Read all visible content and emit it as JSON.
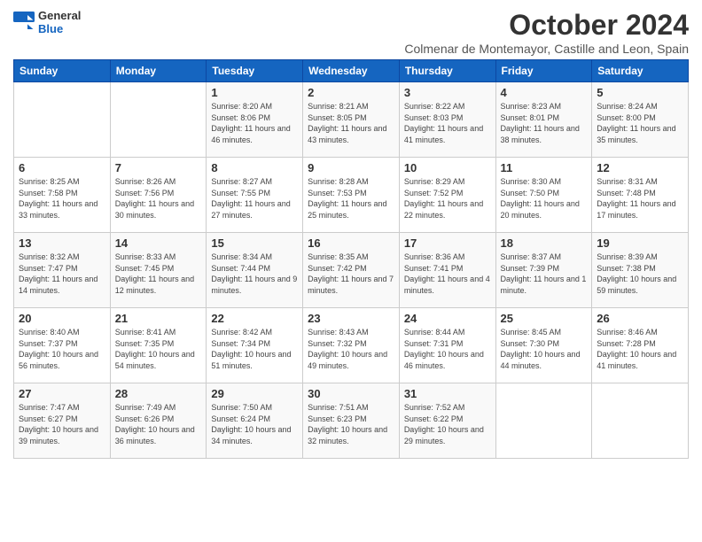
{
  "header": {
    "logo_general": "General",
    "logo_blue": "Blue",
    "title": "October 2024",
    "subtitle": "Colmenar de Montemayor, Castille and Leon, Spain"
  },
  "days_of_week": [
    "Sunday",
    "Monday",
    "Tuesday",
    "Wednesday",
    "Thursday",
    "Friday",
    "Saturday"
  ],
  "weeks": [
    {
      "days": [
        {
          "number": "",
          "info": ""
        },
        {
          "number": "",
          "info": ""
        },
        {
          "number": "1",
          "info": "Sunrise: 8:20 AM\nSunset: 8:06 PM\nDaylight: 11 hours and 46 minutes."
        },
        {
          "number": "2",
          "info": "Sunrise: 8:21 AM\nSunset: 8:05 PM\nDaylight: 11 hours and 43 minutes."
        },
        {
          "number": "3",
          "info": "Sunrise: 8:22 AM\nSunset: 8:03 PM\nDaylight: 11 hours and 41 minutes."
        },
        {
          "number": "4",
          "info": "Sunrise: 8:23 AM\nSunset: 8:01 PM\nDaylight: 11 hours and 38 minutes."
        },
        {
          "number": "5",
          "info": "Sunrise: 8:24 AM\nSunset: 8:00 PM\nDaylight: 11 hours and 35 minutes."
        }
      ]
    },
    {
      "days": [
        {
          "number": "6",
          "info": "Sunrise: 8:25 AM\nSunset: 7:58 PM\nDaylight: 11 hours and 33 minutes."
        },
        {
          "number": "7",
          "info": "Sunrise: 8:26 AM\nSunset: 7:56 PM\nDaylight: 11 hours and 30 minutes."
        },
        {
          "number": "8",
          "info": "Sunrise: 8:27 AM\nSunset: 7:55 PM\nDaylight: 11 hours and 27 minutes."
        },
        {
          "number": "9",
          "info": "Sunrise: 8:28 AM\nSunset: 7:53 PM\nDaylight: 11 hours and 25 minutes."
        },
        {
          "number": "10",
          "info": "Sunrise: 8:29 AM\nSunset: 7:52 PM\nDaylight: 11 hours and 22 minutes."
        },
        {
          "number": "11",
          "info": "Sunrise: 8:30 AM\nSunset: 7:50 PM\nDaylight: 11 hours and 20 minutes."
        },
        {
          "number": "12",
          "info": "Sunrise: 8:31 AM\nSunset: 7:48 PM\nDaylight: 11 hours and 17 minutes."
        }
      ]
    },
    {
      "days": [
        {
          "number": "13",
          "info": "Sunrise: 8:32 AM\nSunset: 7:47 PM\nDaylight: 11 hours and 14 minutes."
        },
        {
          "number": "14",
          "info": "Sunrise: 8:33 AM\nSunset: 7:45 PM\nDaylight: 11 hours and 12 minutes."
        },
        {
          "number": "15",
          "info": "Sunrise: 8:34 AM\nSunset: 7:44 PM\nDaylight: 11 hours and 9 minutes."
        },
        {
          "number": "16",
          "info": "Sunrise: 8:35 AM\nSunset: 7:42 PM\nDaylight: 11 hours and 7 minutes."
        },
        {
          "number": "17",
          "info": "Sunrise: 8:36 AM\nSunset: 7:41 PM\nDaylight: 11 hours and 4 minutes."
        },
        {
          "number": "18",
          "info": "Sunrise: 8:37 AM\nSunset: 7:39 PM\nDaylight: 11 hours and 1 minute."
        },
        {
          "number": "19",
          "info": "Sunrise: 8:39 AM\nSunset: 7:38 PM\nDaylight: 10 hours and 59 minutes."
        }
      ]
    },
    {
      "days": [
        {
          "number": "20",
          "info": "Sunrise: 8:40 AM\nSunset: 7:37 PM\nDaylight: 10 hours and 56 minutes."
        },
        {
          "number": "21",
          "info": "Sunrise: 8:41 AM\nSunset: 7:35 PM\nDaylight: 10 hours and 54 minutes."
        },
        {
          "number": "22",
          "info": "Sunrise: 8:42 AM\nSunset: 7:34 PM\nDaylight: 10 hours and 51 minutes."
        },
        {
          "number": "23",
          "info": "Sunrise: 8:43 AM\nSunset: 7:32 PM\nDaylight: 10 hours and 49 minutes."
        },
        {
          "number": "24",
          "info": "Sunrise: 8:44 AM\nSunset: 7:31 PM\nDaylight: 10 hours and 46 minutes."
        },
        {
          "number": "25",
          "info": "Sunrise: 8:45 AM\nSunset: 7:30 PM\nDaylight: 10 hours and 44 minutes."
        },
        {
          "number": "26",
          "info": "Sunrise: 8:46 AM\nSunset: 7:28 PM\nDaylight: 10 hours and 41 minutes."
        }
      ]
    },
    {
      "days": [
        {
          "number": "27",
          "info": "Sunrise: 7:47 AM\nSunset: 6:27 PM\nDaylight: 10 hours and 39 minutes."
        },
        {
          "number": "28",
          "info": "Sunrise: 7:49 AM\nSunset: 6:26 PM\nDaylight: 10 hours and 36 minutes."
        },
        {
          "number": "29",
          "info": "Sunrise: 7:50 AM\nSunset: 6:24 PM\nDaylight: 10 hours and 34 minutes."
        },
        {
          "number": "30",
          "info": "Sunrise: 7:51 AM\nSunset: 6:23 PM\nDaylight: 10 hours and 32 minutes."
        },
        {
          "number": "31",
          "info": "Sunrise: 7:52 AM\nSunset: 6:22 PM\nDaylight: 10 hours and 29 minutes."
        },
        {
          "number": "",
          "info": ""
        },
        {
          "number": "",
          "info": ""
        }
      ]
    }
  ]
}
